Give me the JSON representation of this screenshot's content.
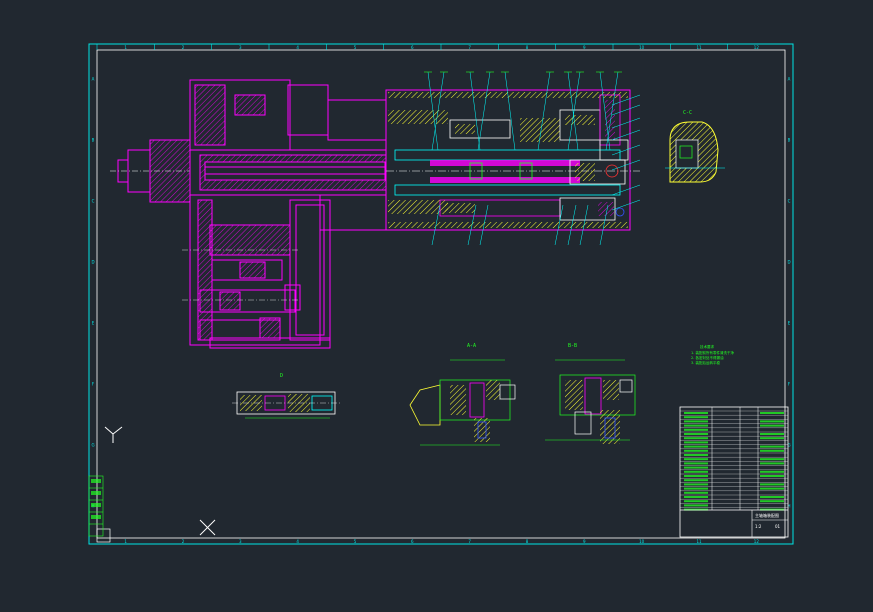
{
  "drawing": {
    "background_color": "#212830",
    "colors": {
      "frame": "#00e5e5",
      "section": "#ff00ff",
      "hatch": "#ffff33",
      "leader": "#00ffff",
      "annotation": "#22ff22",
      "white": "#ffffff",
      "red": "#ff3333",
      "blue": "#3355ff"
    },
    "border_letters_top": [
      "1",
      "2",
      "3",
      "4",
      "5",
      "6",
      "7",
      "8",
      "9",
      "10",
      "11",
      "12"
    ],
    "border_letters_side": [
      "A",
      "B",
      "C",
      "D",
      "E",
      "F",
      "G",
      "H"
    ],
    "view_labels": {
      "section_a": "A-A",
      "section_b": "B-B",
      "detail_c": "C-C",
      "partial_view": "D"
    },
    "tech_notes": [
      "技术要求",
      "1. 装配前所有零件清洗干净",
      "2. 各密封处不得漏油",
      "3. 装配后运转平稳"
    ],
    "title_block": {
      "name": "主轴箱装配图",
      "scale": "1:2",
      "sheet": "01"
    },
    "revision_block": [
      "标记",
      "处数",
      "签名",
      "日期",
      "设计",
      "审核"
    ]
  }
}
